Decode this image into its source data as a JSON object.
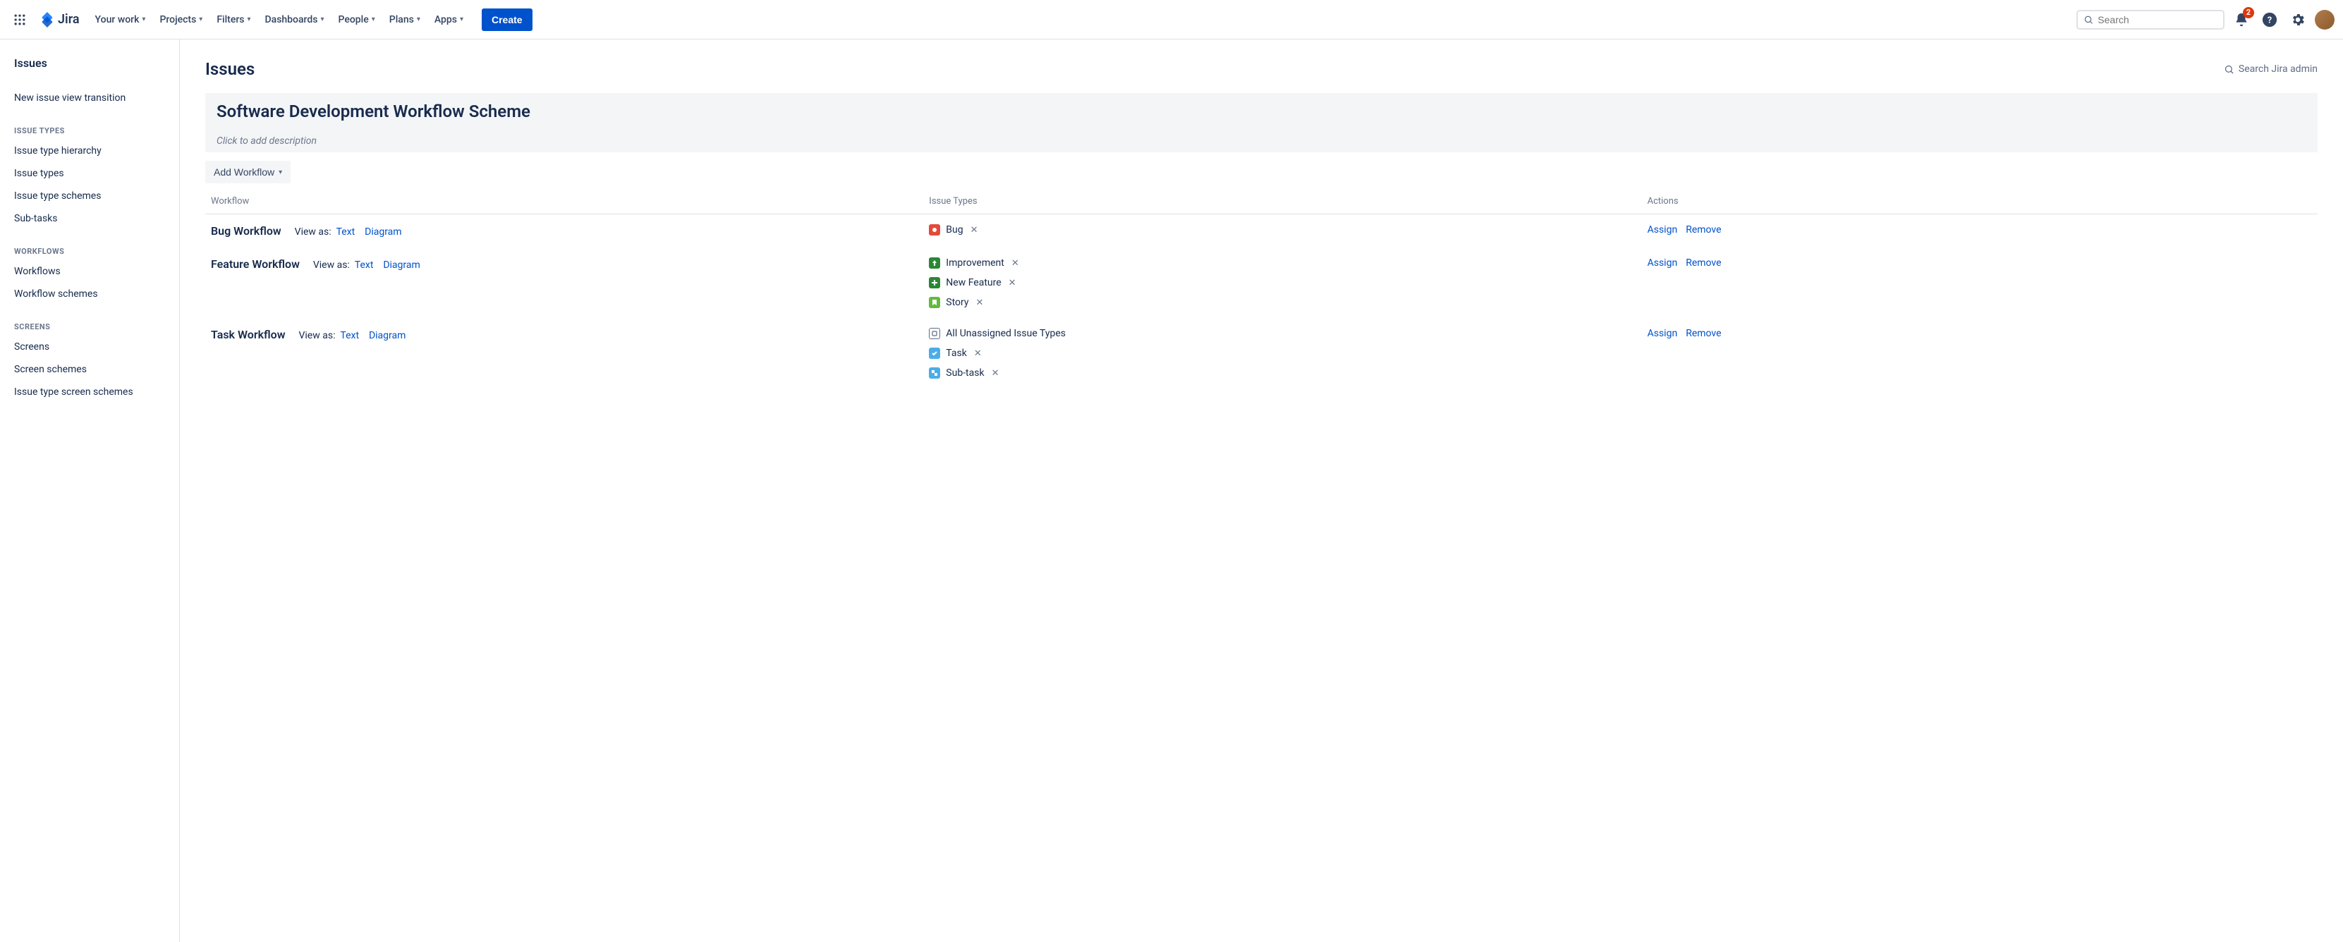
{
  "topnav": {
    "product": "Jira",
    "items": [
      "Your work",
      "Projects",
      "Filters",
      "Dashboards",
      "People",
      "Plans",
      "Apps"
    ],
    "create": "Create",
    "search_placeholder": "Search",
    "notif_count": "2"
  },
  "sidebar": {
    "title": "Issues",
    "top_links": [
      "New issue view transition"
    ],
    "groups": [
      {
        "label": "ISSUE TYPES",
        "items": [
          "Issue type hierarchy",
          "Issue types",
          "Issue type schemes",
          "Sub-tasks"
        ]
      },
      {
        "label": "WORKFLOWS",
        "items": [
          "Workflows",
          "Workflow schemes"
        ]
      },
      {
        "label": "SCREENS",
        "items": [
          "Screens",
          "Screen schemes",
          "Issue type screen schemes"
        ]
      }
    ]
  },
  "main": {
    "heading": "Issues",
    "admin_search": "Search Jira admin",
    "scheme_name": "Software Development Workflow Scheme",
    "desc_placeholder": "Click to add description",
    "add_workflow": "Add Workflow",
    "columns": {
      "workflow": "Workflow",
      "issue_types": "Issue Types",
      "actions": "Actions"
    },
    "view_as_label": "View as:",
    "view_text": "Text",
    "view_diagram": "Diagram",
    "assign": "Assign",
    "remove": "Remove",
    "rows": [
      {
        "name": "Bug Workflow",
        "types": [
          {
            "label": "Bug",
            "icon": "bug"
          }
        ]
      },
      {
        "name": "Feature Workflow",
        "types": [
          {
            "label": "Improvement",
            "icon": "improve"
          },
          {
            "label": "New Feature",
            "icon": "feature"
          },
          {
            "label": "Story",
            "icon": "story"
          }
        ]
      },
      {
        "name": "Task Workflow",
        "types": [
          {
            "label": "All Unassigned Issue Types",
            "icon": "unassigned",
            "no_remove": true
          },
          {
            "label": "Task",
            "icon": "task"
          },
          {
            "label": "Sub-task",
            "icon": "subtask"
          }
        ]
      }
    ]
  }
}
